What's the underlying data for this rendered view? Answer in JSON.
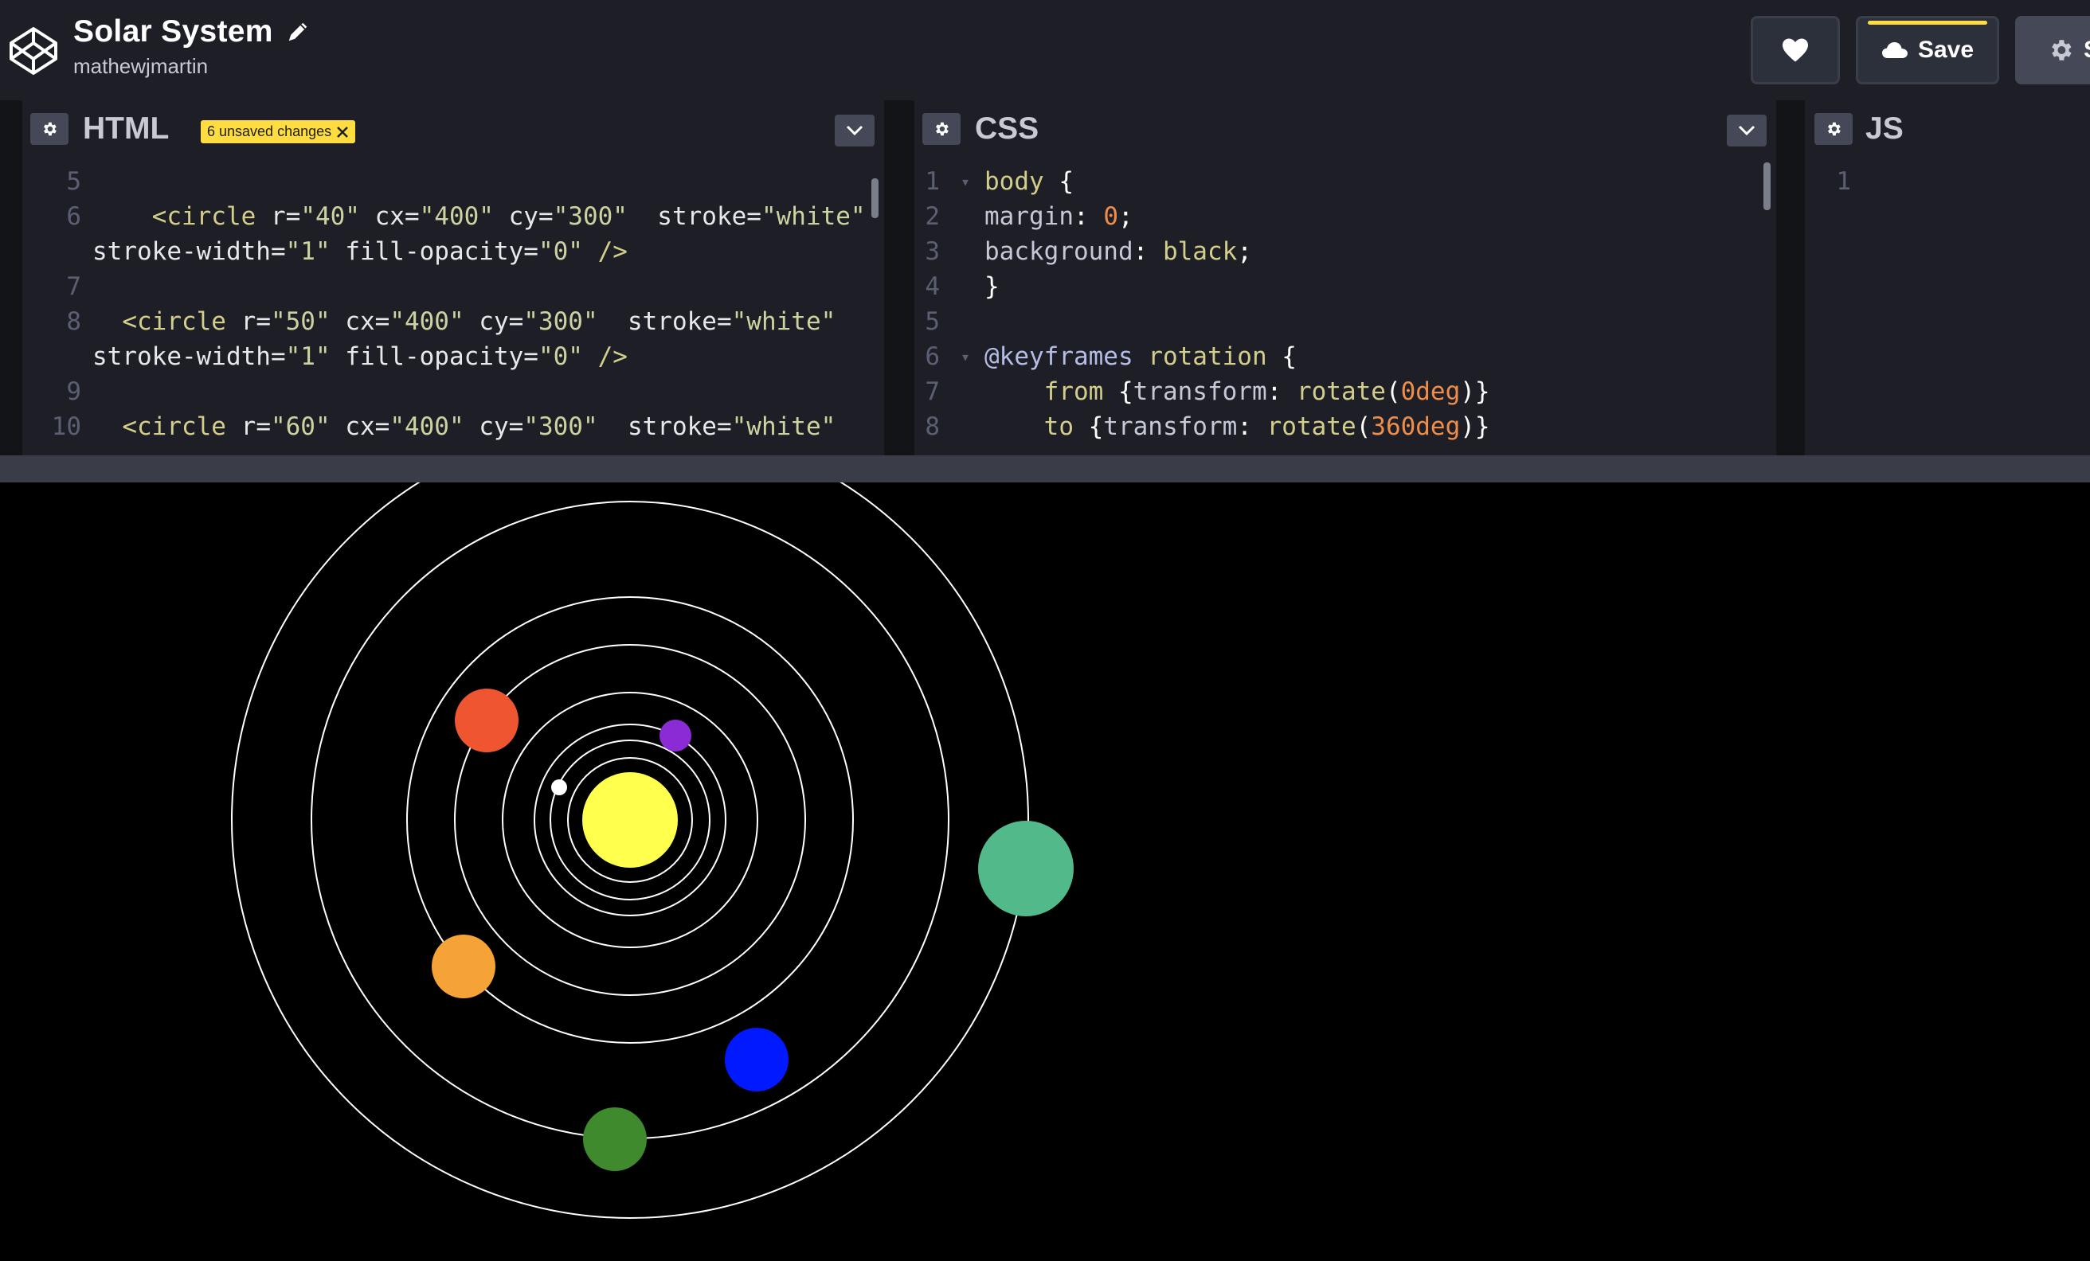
{
  "header": {
    "title": "Solar System",
    "username": "mathewjmartin",
    "save_label": "Save",
    "settings_label": "S"
  },
  "panels": {
    "html": {
      "title": "HTML",
      "badge": "6 unsaved changes",
      "lines": [
        {
          "n": "5",
          "text": ""
        },
        {
          "n": "6",
          "text": "    <circle r=\"40\" cx=\"400\" cy=\"300\"  stroke=\"white\""
        },
        {
          "n": "",
          "text": "stroke-width=\"1\" fill-opacity=\"0\" />"
        },
        {
          "n": "7",
          "text": ""
        },
        {
          "n": "8",
          "text": "  <circle r=\"50\" cx=\"400\" cy=\"300\"  stroke=\"white\""
        },
        {
          "n": "",
          "text": "stroke-width=\"1\" fill-opacity=\"0\" />"
        },
        {
          "n": "9",
          "text": ""
        },
        {
          "n": "10",
          "text": "  <circle r=\"60\" cx=\"400\" cy=\"300\"  stroke=\"white\""
        }
      ]
    },
    "css": {
      "title": "CSS",
      "lines": [
        {
          "n": "1",
          "text": "body {"
        },
        {
          "n": "2",
          "text": "margin: 0;"
        },
        {
          "n": "3",
          "text": "background: black;"
        },
        {
          "n": "4",
          "text": "}"
        },
        {
          "n": "5",
          "text": ""
        },
        {
          "n": "6",
          "text": "@keyframes rotation {"
        },
        {
          "n": "7",
          "text": "    from {transform: rotate(0deg)}"
        },
        {
          "n": "8",
          "text": "    to {transform: rotate(360deg)}"
        }
      ]
    },
    "js": {
      "title": "JS",
      "lines": [
        {
          "n": "1",
          "text": ""
        }
      ]
    }
  },
  "scene": {
    "sun_color": "#ffff4d",
    "orbit_color": "#ffffff",
    "planets": [
      {
        "name": "white-moon",
        "color": "#ffffff"
      },
      {
        "name": "purple-planet",
        "color": "#8a2bd6"
      },
      {
        "name": "red-planet",
        "color": "#ef5530"
      },
      {
        "name": "orange-planet",
        "color": "#f5a236"
      },
      {
        "name": "blue-planet",
        "color": "#0019ff"
      },
      {
        "name": "dark-green-planet",
        "color": "#3e8a2c"
      },
      {
        "name": "teal-planet",
        "color": "#52b98a"
      }
    ]
  },
  "colors": {
    "accent": "#ffdd40",
    "topbar": "#1e1f26",
    "button": "#444857"
  }
}
